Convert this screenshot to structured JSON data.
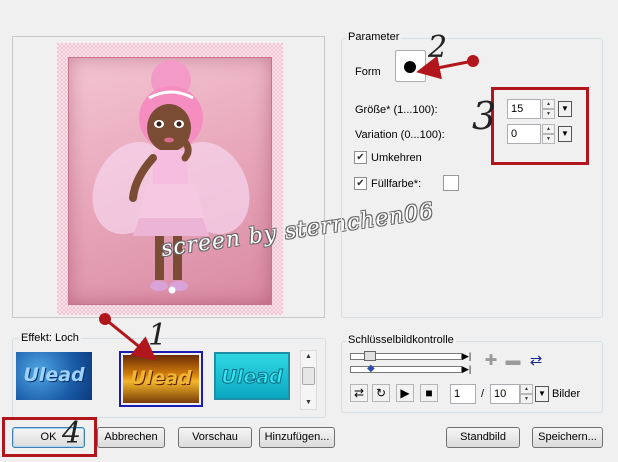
{
  "preview": {
    "watermark": "screen by sternchen06"
  },
  "effects": {
    "group_label": "Effekt: Loch",
    "thumbnails": [
      {
        "label": "Ulead"
      },
      {
        "label": "Ulead"
      },
      {
        "label": "Ulead"
      }
    ],
    "selected_index": 1
  },
  "parameter": {
    "group_label": "Parameter",
    "form_label": "Form",
    "size_label": "Größe* (1...100):",
    "size_value": "15",
    "variation_label": "Variation (0...100):",
    "variation_value": "0",
    "invert_label": "Umkehren",
    "invert_checked": true,
    "fill_label": "Füllfarbe*:",
    "fill_checked": true,
    "fill_color": "#ffffff"
  },
  "keyframes": {
    "group_label": "Schlüsselbildkontrolle",
    "frame_current": "1",
    "frame_separator": "/",
    "frame_total": "10",
    "frames_label": "Bilder"
  },
  "buttons": {
    "ok": "OK",
    "cancel": "Abbrechen",
    "preview": "Vorschau",
    "add": "Hinzufügen...",
    "default": "Standbild",
    "save": "Speichern..."
  },
  "annotations": {
    "step1": "1",
    "step2": "2",
    "step3": "3",
    "step4": "4",
    "marker_color": "#b1161c"
  }
}
